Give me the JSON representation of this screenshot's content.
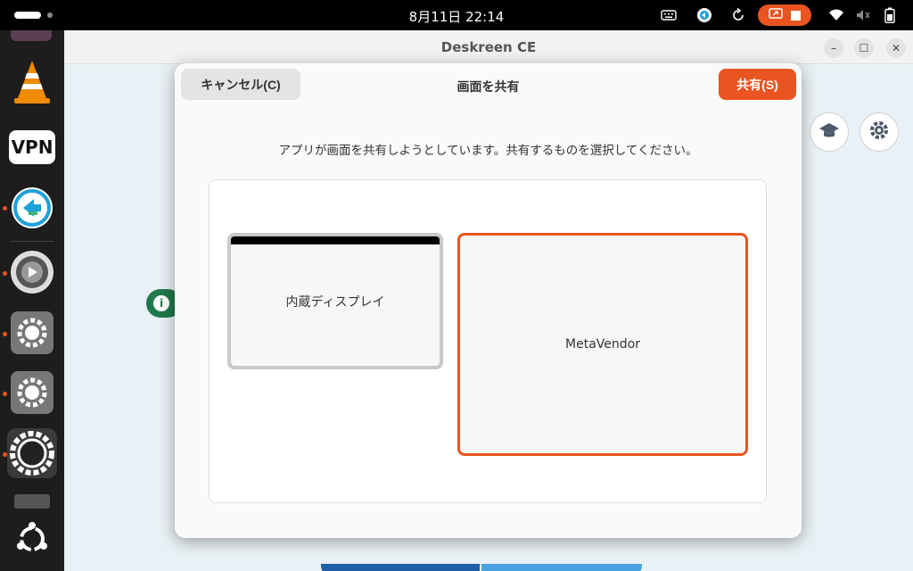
{
  "topbar": {
    "clock": "8月11日  22:14",
    "icons": [
      "keyboard-icon",
      "deskreen-tray-icon",
      "refresh-icon",
      "screen-share-icon",
      "stop-icon",
      "wifi-icon",
      "volume-muted-icon",
      "battery-icon"
    ],
    "accent": "#e95420"
  },
  "dock": {
    "apps": [
      "vlc-icon",
      "vpn-icon",
      "remote-desktop-icon",
      "settings-gear-icon",
      "settings-gear-icon",
      "settings-gear-icon",
      "deskreen-icon",
      "ubuntu-apps-icon"
    ],
    "vpn_label": "VPN"
  },
  "app": {
    "title": "Deskreen CE"
  },
  "dialog": {
    "cancel_label": "キャンセル(C)",
    "title": "画面を共有",
    "share_label": "共有(S)",
    "description": "アプリが画面を共有しようとしています。共有するものを選択してください。",
    "sources": [
      {
        "label": "内蔵ディスプレイ",
        "selected": false
      },
      {
        "label": "MetaVendor",
        "selected": true
      }
    ]
  }
}
